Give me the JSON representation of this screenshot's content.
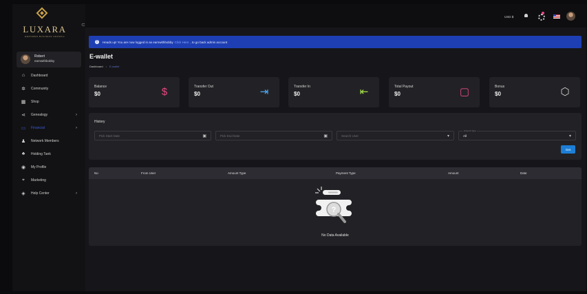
{
  "sidebar": {
    "logo_text": "LUXARA",
    "logo_tagline": "EMPOWER BUSINESS GROWTH",
    "user": {
      "name": "Robert",
      "handle": "earnwithbobby"
    },
    "items": [
      {
        "label": "Dashboard",
        "icon": "dashboard-icon",
        "glyph": "⌂",
        "has_chevron": false,
        "active": false
      },
      {
        "label": "Community",
        "icon": "community-icon",
        "glyph": "✲",
        "has_chevron": false,
        "active": false
      },
      {
        "label": "Shop",
        "icon": "shop-icon",
        "glyph": "▦",
        "has_chevron": false,
        "active": false
      },
      {
        "label": "Genealogy",
        "icon": "genealogy-icon",
        "glyph": "⋖",
        "has_chevron": true,
        "active": false
      },
      {
        "label": "Financial",
        "icon": "financial-icon",
        "glyph": "▭",
        "has_chevron": true,
        "active": true
      },
      {
        "label": "Network Members",
        "icon": "network-members-icon",
        "glyph": "♟",
        "has_chevron": false,
        "active": false
      },
      {
        "label": "Holding Tank",
        "icon": "holding-tank-icon",
        "glyph": "♣",
        "has_chevron": false,
        "active": false
      },
      {
        "label": "My Profile",
        "icon": "profile-icon",
        "glyph": "◉",
        "has_chevron": false,
        "active": false
      },
      {
        "label": "Marketing",
        "icon": "marketing-icon",
        "glyph": "⌖",
        "has_chevron": false,
        "active": false
      },
      {
        "label": "Help Center",
        "icon": "help-center-icon",
        "glyph": "◈",
        "has_chevron": true,
        "active": false
      }
    ]
  },
  "topbar": {
    "currency": "USD $"
  },
  "alert": {
    "prefix": "Heads up! You are now logged in as earnwithbobby",
    "link": "Click Here",
    "suffix": ", to go back admin account"
  },
  "page": {
    "title": "E-wallet",
    "breadcrumb": [
      "Dashboard",
      "E-wallet"
    ]
  },
  "cards": [
    {
      "label": "Balance",
      "value": "$0",
      "icon": "balance-icon",
      "glyph": "$",
      "color": "#e64980"
    },
    {
      "label": "Transfer Out",
      "value": "$0",
      "icon": "transfer-out-icon",
      "glyph": "⇥",
      "color": "#4dabf7"
    },
    {
      "label": "Transfer In",
      "value": "$0",
      "icon": "transfer-in-icon",
      "glyph": "⇤",
      "color": "#a9e34b"
    },
    {
      "label": "Total Payout",
      "value": "$0",
      "icon": "wallet-icon",
      "glyph": "▢",
      "color": "#e64980"
    },
    {
      "label": "Bonus",
      "value": "$0",
      "icon": "bonus-icon",
      "glyph": "⬡",
      "color": "#d0d0d0"
    }
  ],
  "history": {
    "title": "History",
    "start_date_placeholder": "Pick Start Date",
    "end_date_placeholder": "Pick End Date",
    "search_user_placeholder": "Search User",
    "amount_type_label": "Amount Type",
    "amount_type_value": "All",
    "get_label": "Get"
  },
  "table": {
    "columns": [
      "No",
      "From User",
      "Amount Type",
      "Payment Type",
      "Amount",
      "Date"
    ],
    "empty_text": "No Data Available"
  },
  "colors": {
    "accent": "#1c7ed6",
    "alert_bg": "#1e3fb4",
    "active_nav": "#3b5bdb",
    "card_bg": "#222226"
  }
}
